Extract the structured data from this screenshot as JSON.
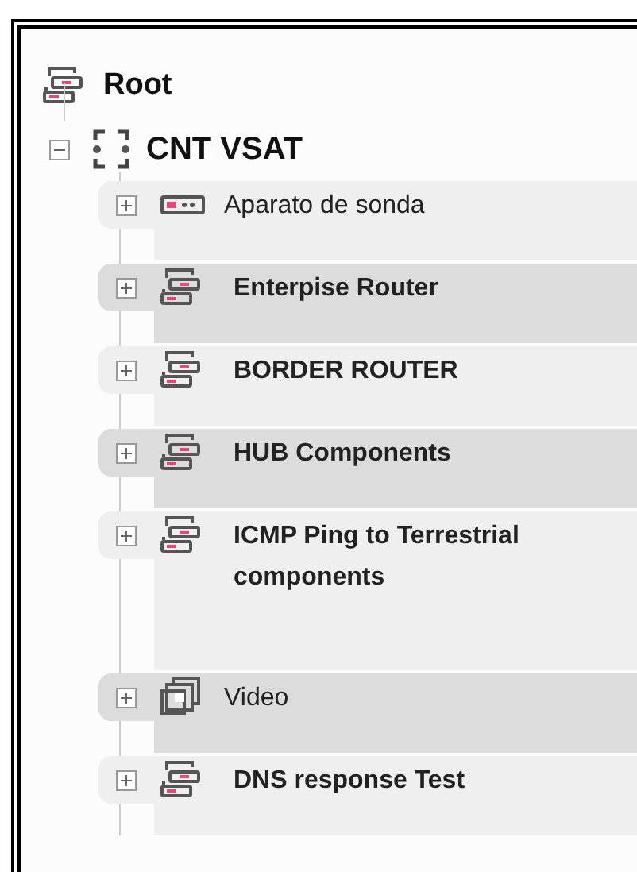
{
  "tree": {
    "label": "Root",
    "children": [
      {
        "label": "CNT VSAT",
        "expanded": true,
        "children": [
          {
            "label": "Aparato de sonda",
            "kind": "probe",
            "expanded": false
          },
          {
            "label": "Enterpise Router",
            "kind": "router",
            "expanded": false
          },
          {
            "label": "BORDER ROUTER",
            "kind": "router",
            "expanded": false
          },
          {
            "label": "HUB Components",
            "kind": "router",
            "expanded": false
          },
          {
            "label": "ICMP Ping to Terrestrial components",
            "kind": "router",
            "expanded": false
          },
          {
            "label": "Video",
            "kind": "video",
            "expanded": false
          },
          {
            "label": "DNS response Test",
            "kind": "router",
            "expanded": false
          }
        ]
      }
    ]
  }
}
